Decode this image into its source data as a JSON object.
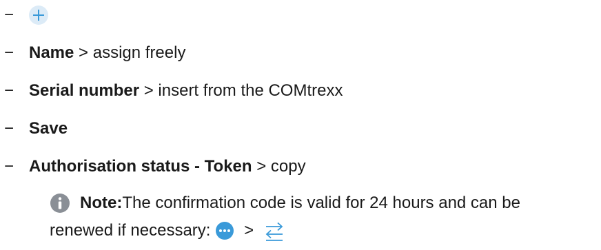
{
  "steps": {
    "dash": "−",
    "add": {
      "icon": "plus-circle-icon"
    },
    "name": {
      "label": "Name",
      "rest": " > assign freely"
    },
    "serial": {
      "label": "Serial number",
      "rest": " > insert from the COMtrexx"
    },
    "save": {
      "label": "Save"
    },
    "auth": {
      "label": "Authorisation status - Token",
      "rest": " > copy"
    }
  },
  "note": {
    "icon": "info-icon",
    "label": "Note:",
    "text": "The confirmation code is valid for 24 hours and can be",
    "text2": "renewed if necessary:",
    "sep": " > ",
    "more_icon": "more-dots-icon",
    "renew_icon": "swap-arrows-icon"
  },
  "colors": {
    "accent": "#3a9ad9",
    "accent_light": "#dcebf7",
    "info_grey": "#8a8f96",
    "text": "#1a1a1a"
  }
}
